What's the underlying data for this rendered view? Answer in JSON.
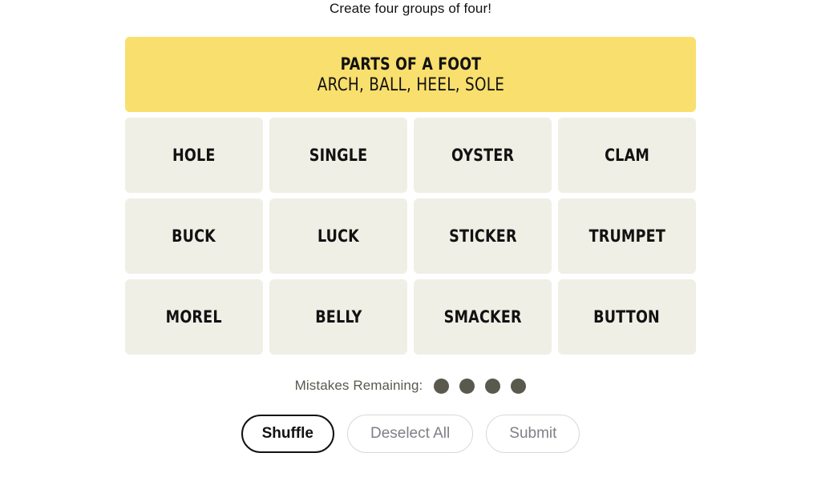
{
  "game": {
    "instruction": "Create four groups of four!",
    "solved_groups": [
      {
        "title": "PARTS OF A FOOT",
        "words_text": "ARCH, BALL, HEEL, SOLE",
        "color": "#f9df6d"
      }
    ],
    "tile_rows": [
      [
        "HOLE",
        "SINGLE",
        "OYSTER",
        "CLAM"
      ],
      [
        "BUCK",
        "LUCK",
        "STICKER",
        "TRUMPET"
      ],
      [
        "MOREL",
        "BELLY",
        "SMACKER",
        "BUTTON"
      ]
    ],
    "mistakes": {
      "label": "Mistakes Remaining:",
      "remaining": 4,
      "dot_color": "#5a594e"
    },
    "controls": {
      "shuffle_label": "Shuffle",
      "deselect_label": "Deselect All",
      "submit_label": "Submit"
    },
    "colors": {
      "tile_background": "#efefe6",
      "text": "#121212",
      "disabled_text": "#7f7f87",
      "page_background": "#ffffff"
    }
  }
}
